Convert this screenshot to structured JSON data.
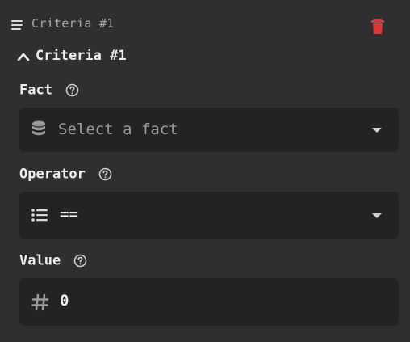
{
  "header": {
    "title": "Criteria #1"
  },
  "section": {
    "title": "Criteria #1"
  },
  "fields": {
    "fact": {
      "label": "Fact",
      "placeholder": "Select a fact",
      "icon": "database-icon"
    },
    "operator": {
      "label": "Operator",
      "value": "==",
      "icon": "list-icon"
    },
    "value": {
      "label": "Value",
      "value": "0",
      "icon": "hash-icon"
    }
  },
  "colors": {
    "background": "#2f2f2f",
    "field_background": "#232323",
    "danger": "#e03535",
    "text": "#ededed",
    "muted": "#9a9a9a"
  }
}
